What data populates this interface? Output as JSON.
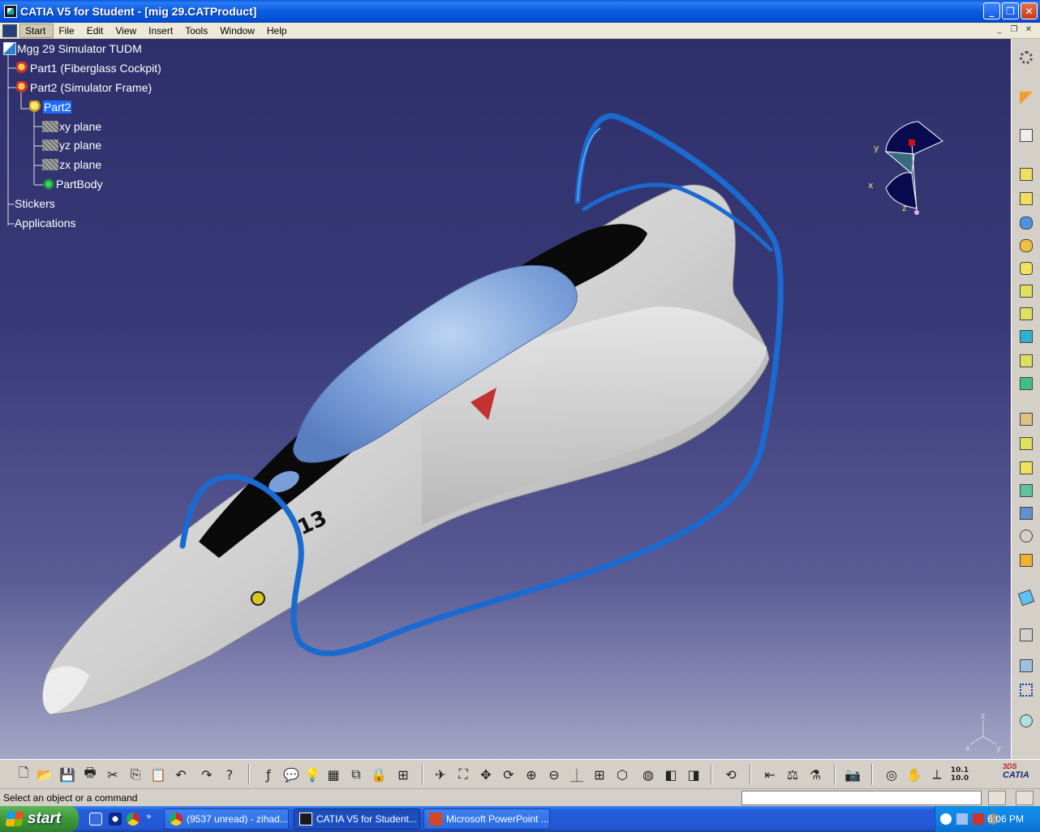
{
  "window": {
    "title": "CATIA V5 for Student - [mig 29.CATProduct]",
    "minimize": "_",
    "restore": "❐",
    "close": "✕"
  },
  "menu": {
    "items": [
      "Start",
      "File",
      "Edit",
      "View",
      "Insert",
      "Tools",
      "Window",
      "Help"
    ],
    "active": "Start"
  },
  "tree": {
    "root": "Mgg 29 Simulator TUDM",
    "part1": "Part1 (Fiberglass Cockpit)",
    "part2": "Part2 (Simulator Frame)",
    "part2_child": "Part2",
    "xy": "xy plane",
    "yz": "yz plane",
    "zx": "zx plane",
    "body": "PartBody",
    "stickers": "Stickers",
    "applications": "Applications"
  },
  "model": {
    "tail_number": "13",
    "canopy_color": "#7aa0d8",
    "fuselage_color": "#d6d6d6",
    "frame_color": "#1a6ad0"
  },
  "compass": {
    "x": "x",
    "y": "y",
    "z": "z"
  },
  "axes": {
    "x": "x",
    "y": "y",
    "z": "z"
  },
  "bottom_toolbar": {
    "logo": "CATIA",
    "logo_mark": "3DS",
    "measure_label": "10.1 10.0"
  },
  "status": {
    "message": "Select an object or a command",
    "command_value": ""
  },
  "taskbar": {
    "start": "start",
    "tasks": [
      {
        "label": "(9537 unread) - zihad...",
        "icon": "chrome-icon"
      },
      {
        "label": "CATIA V5 for Student...",
        "icon": "catia-icon"
      },
      {
        "label": "Microsoft PowerPoint ...",
        "icon": "powerpoint-icon"
      }
    ],
    "clock": "6:06 PM",
    "quick_launch_more": "»"
  },
  "colors": {
    "titlebar": "#0a5ae0",
    "viewport_top": "#2e2f6a",
    "viewport_bottom": "#a4a6c6",
    "selection": "#1e6cff"
  }
}
